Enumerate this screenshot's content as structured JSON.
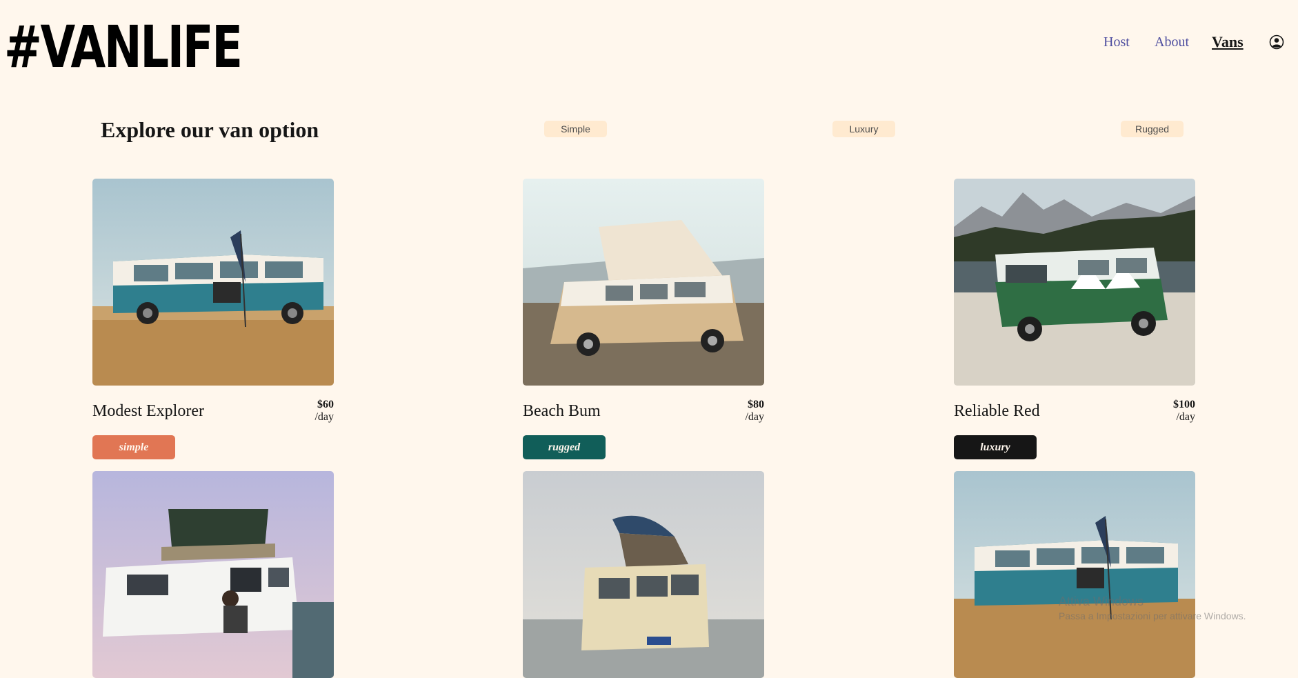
{
  "header": {
    "logo": "#VANLIFE",
    "nav": {
      "host": "Host",
      "about": "About",
      "vans": "Vans"
    },
    "user_icon": "user-circle-icon"
  },
  "filters": {
    "heading": "Explore our van option",
    "options": [
      "Simple",
      "Luxury",
      "Rugged"
    ]
  },
  "vans": [
    {
      "name": "Modest Explorer",
      "price": "$60",
      "unit": "/day",
      "type": "simple",
      "type_color": "#E17654"
    },
    {
      "name": "Beach Bum",
      "price": "$80",
      "unit": "/day",
      "type": "rugged",
      "type_color": "#115E59"
    },
    {
      "name": "Reliable Red",
      "price": "$100",
      "unit": "/day",
      "type": "luxury",
      "type_color": "#161616"
    }
  ],
  "watermark": {
    "title": "Attiva Windows",
    "subtitle": "Passa a Impostazioni per attivare Windows."
  },
  "colors": {
    "background": "#FFF7ED",
    "filter_bg": "#FFEAD0",
    "nav_link": "#4D4D9F",
    "simple": "#E17654",
    "rugged": "#115E59",
    "luxury": "#161616"
  }
}
